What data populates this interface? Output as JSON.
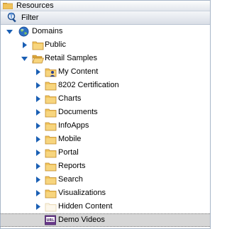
{
  "header": {
    "title": "Resources",
    "icon": "folder-icon"
  },
  "filter": {
    "label": "Filter",
    "icon": "filter-icon"
  },
  "tree": {
    "root": {
      "label": "Domains",
      "icon": "globe-icon",
      "expanded": true
    },
    "domains": [
      {
        "label": "Public",
        "icon": "folder-icon",
        "expanded": false
      },
      {
        "label": "Retail Samples",
        "icon": "folder-open-icon",
        "expanded": true
      }
    ],
    "retail_samples_children": [
      {
        "label": "My Content",
        "icon": "my-content-folder-icon",
        "expanded": false
      },
      {
        "label": "8202 Certification",
        "icon": "folder-icon",
        "expanded": false
      },
      {
        "label": "Charts",
        "icon": "folder-icon",
        "expanded": false
      },
      {
        "label": "Documents",
        "icon": "folder-icon",
        "expanded": false
      },
      {
        "label": "InfoApps",
        "icon": "folder-icon",
        "expanded": false
      },
      {
        "label": "Mobile",
        "icon": "folder-icon",
        "expanded": false
      },
      {
        "label": "Portal",
        "icon": "folder-icon",
        "expanded": false
      },
      {
        "label": "Reports",
        "icon": "folder-icon",
        "expanded": false
      },
      {
        "label": "Search",
        "icon": "folder-icon",
        "expanded": false
      },
      {
        "label": "Visualizations",
        "icon": "folder-icon",
        "expanded": false
      },
      {
        "label": "Hidden Content",
        "icon": "hidden-folder-icon",
        "expanded": false
      }
    ],
    "selected_item": {
      "label": "Demo Videos",
      "icon": "url-link-icon",
      "icon_text": "URL"
    }
  },
  "colors": {
    "arrow": "#1a5fb4",
    "folder": "#e8b84a",
    "selection_bg": "#d6d6d6",
    "border": "#a8b6c8"
  }
}
